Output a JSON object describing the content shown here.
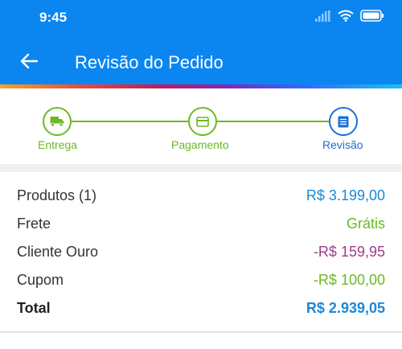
{
  "status_bar": {
    "time": "9:45"
  },
  "header": {
    "title": "Revisão do Pedido",
    "back_icon": "arrow-left-icon"
  },
  "stepper": {
    "steps": [
      {
        "label": "Entrega",
        "icon": "truck-icon",
        "state": "done"
      },
      {
        "label": "Pagamento",
        "icon": "credit-card-icon",
        "state": "done"
      },
      {
        "label": "Revisão",
        "icon": "list-icon",
        "state": "current"
      }
    ]
  },
  "summary": {
    "rows": [
      {
        "label": "Produtos (1)",
        "value": "R$ 3.199,00",
        "color": "#1b88d8"
      },
      {
        "label": "Frete",
        "value": "Grátis",
        "color": "#6cb923"
      },
      {
        "label": "Cliente Ouro",
        "value": "-R$ 159,95",
        "color": "#a03c8a"
      },
      {
        "label": "Cupom",
        "value": "-R$ 100,00",
        "color": "#6cb923"
      },
      {
        "label": "Total",
        "value": "R$ 2.939,05",
        "color": "#1b88d8"
      }
    ]
  },
  "colors": {
    "primary": "#0b86f0",
    "step_done": "#6cb923",
    "step_current": "#1b6fd8"
  }
}
